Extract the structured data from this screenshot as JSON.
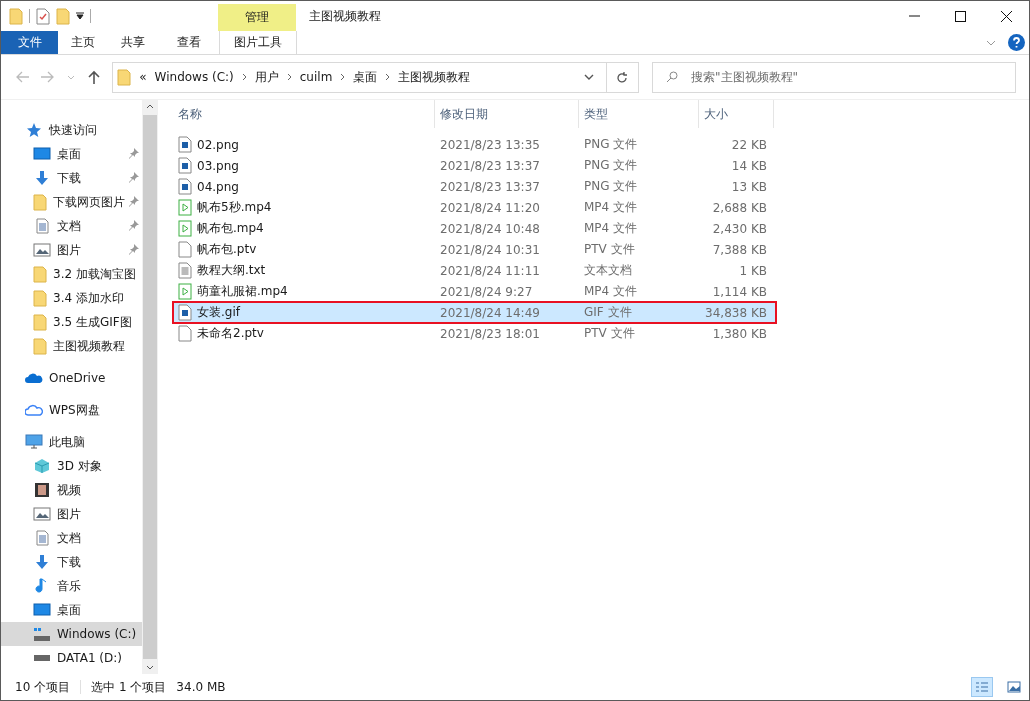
{
  "window": {
    "title": "主图视频教程"
  },
  "ribbon": {
    "tabs": [
      {
        "label": "文件",
        "kind": "file"
      },
      {
        "label": "主页",
        "kind": "plain"
      },
      {
        "label": "共享",
        "kind": "plain"
      },
      {
        "label": "查看",
        "kind": "plain"
      },
      {
        "label": "图片工具",
        "kind": "context",
        "header": "管理"
      }
    ]
  },
  "address": {
    "path": [
      "Windows (C:)",
      "用户",
      "cuilm",
      "桌面",
      "主图视频教程"
    ],
    "overflow": "«"
  },
  "search": {
    "placeholder": "搜索\"主图视频教程\""
  },
  "sidebar": {
    "items": [
      {
        "label": "快速访问",
        "kind": "star",
        "selected": false,
        "children": [
          {
            "label": "桌面",
            "kind": "desktop",
            "pinned": true,
            "selected": false
          },
          {
            "label": "下载",
            "kind": "download",
            "pinned": true,
            "selected": false
          },
          {
            "label": "下载网页图片",
            "kind": "folder",
            "pinned": true,
            "selected": false
          },
          {
            "label": "文档",
            "kind": "doc",
            "pinned": true,
            "selected": false
          },
          {
            "label": "图片",
            "kind": "picture",
            "pinned": true,
            "selected": false
          },
          {
            "label": "3.2 加载淘宝图",
            "kind": "folder",
            "pinned": false,
            "selected": false
          },
          {
            "label": "3.4 添加水印",
            "kind": "folder",
            "pinned": false,
            "selected": false
          },
          {
            "label": "3.5 生成GIF图",
            "kind": "folder",
            "pinned": false,
            "selected": false
          },
          {
            "label": "主图视频教程",
            "kind": "folder",
            "pinned": false,
            "selected": false
          }
        ]
      },
      {
        "label": "OneDrive",
        "kind": "onedrive",
        "selected": false
      },
      {
        "label": "WPS网盘",
        "kind": "cloud",
        "selected": false
      },
      {
        "label": "此电脑",
        "kind": "pc",
        "selected": false,
        "children": [
          {
            "label": "3D 对象",
            "kind": "cube",
            "pinned": false,
            "selected": false
          },
          {
            "label": "视频",
            "kind": "video",
            "pinned": false,
            "selected": false
          },
          {
            "label": "图片",
            "kind": "picture",
            "pinned": false,
            "selected": false
          },
          {
            "label": "文档",
            "kind": "doc",
            "pinned": false,
            "selected": false
          },
          {
            "label": "下载",
            "kind": "download",
            "pinned": false,
            "selected": false
          },
          {
            "label": "音乐",
            "kind": "music",
            "pinned": false,
            "selected": false
          },
          {
            "label": "桌面",
            "kind": "desktop",
            "pinned": false,
            "selected": false
          },
          {
            "label": "Windows (C:)",
            "kind": "drive-win",
            "pinned": false,
            "selected": true
          },
          {
            "label": "DATA1 (D:)",
            "kind": "drive",
            "pinned": false,
            "selected": false
          }
        ]
      }
    ]
  },
  "table": {
    "columns": [
      "名称",
      "修改日期",
      "类型",
      "大小"
    ],
    "rows": [
      {
        "name": "02.png",
        "kind": "image",
        "date": "2021/8/23 13:35",
        "type": "PNG 文件",
        "size": "22 KB",
        "selected": false
      },
      {
        "name": "03.png",
        "kind": "image",
        "date": "2021/8/23 13:37",
        "type": "PNG 文件",
        "size": "14 KB",
        "selected": false
      },
      {
        "name": "04.png",
        "kind": "image",
        "date": "2021/8/23 13:37",
        "type": "PNG 文件",
        "size": "13 KB",
        "selected": false
      },
      {
        "name": "帆布5秒.mp4",
        "kind": "video",
        "date": "2021/8/24 11:20",
        "type": "MP4 文件",
        "size": "2,688 KB",
        "selected": false
      },
      {
        "name": "帆布包.mp4",
        "kind": "video",
        "date": "2021/8/24 10:48",
        "type": "MP4 文件",
        "size": "2,430 KB",
        "selected": false
      },
      {
        "name": "帆布包.ptv",
        "kind": "blank",
        "date": "2021/8/24 10:31",
        "type": "PTV 文件",
        "size": "7,388 KB",
        "selected": false
      },
      {
        "name": "教程大纲.txt",
        "kind": "text",
        "date": "2021/8/24 11:11",
        "type": "文本文档",
        "size": "1 KB",
        "selected": false
      },
      {
        "name": "萌童礼服裙.mp4",
        "kind": "video",
        "date": "2021/8/24 9:27",
        "type": "MP4 文件",
        "size": "1,114 KB",
        "selected": false
      },
      {
        "name": "女装.gif",
        "kind": "image",
        "date": "2021/8/24 14:49",
        "type": "GIF 文件",
        "size": "34,838 KB",
        "selected": true
      },
      {
        "name": "未命名2.ptv",
        "kind": "blank",
        "date": "2021/8/23 18:01",
        "type": "PTV 文件",
        "size": "1,380 KB",
        "selected": false
      }
    ]
  },
  "status_bar": {
    "count": "10 个项目",
    "selection": "选中 1 个项目",
    "size": "34.0 MB",
    "views": [
      {
        "kind": "details",
        "selected": true
      },
      {
        "kind": "icons",
        "selected": false
      }
    ]
  }
}
